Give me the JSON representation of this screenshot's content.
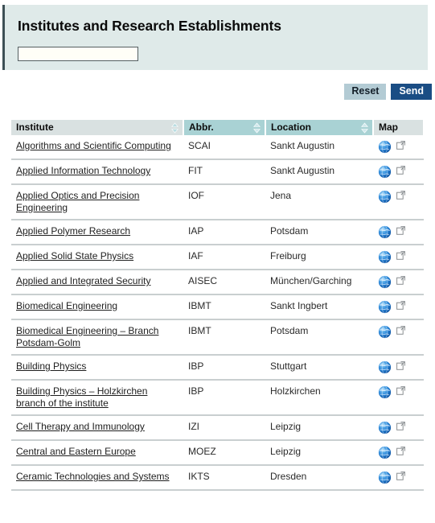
{
  "header": {
    "title": "Institutes and Research Establishments",
    "search": {
      "value": "",
      "placeholder": ""
    }
  },
  "actions": {
    "reset_label": "Reset",
    "send_label": "Send"
  },
  "colors": {
    "panel_bg": "#dfeae9",
    "header_plain": "#d9e1e1",
    "header_accent": "#a9d2d4",
    "send_bg": "#1a4d84",
    "reset_bg": "#b3cbd4",
    "globe_blue": "#1c6fc4",
    "row_divider": "#c9cfd0"
  },
  "table": {
    "columns": [
      {
        "key": "institute",
        "label": "Institute",
        "sortable": true,
        "icon": "sort-arrows-icon"
      },
      {
        "key": "abbr",
        "label": "Abbr.",
        "sortable": true,
        "icon": "sort-arrows-icon"
      },
      {
        "key": "location",
        "label": "Location",
        "sortable": true,
        "icon": "sort-arrows-icon"
      },
      {
        "key": "map",
        "label": "Map",
        "sortable": false,
        "icon": ""
      }
    ],
    "rows": [
      {
        "institute": "Algorithms and Scientific Computing",
        "abbr": "SCAI",
        "location": "Sankt Augustin",
        "map_icon": "globe-icon",
        "link_icon": "external-link-icon"
      },
      {
        "institute": "Applied Information Technology",
        "abbr": "FIT",
        "location": "Sankt Augustin",
        "map_icon": "globe-icon",
        "link_icon": "external-link-icon"
      },
      {
        "institute": "Applied Optics and Precision Engineering",
        "abbr": "IOF",
        "location": "Jena",
        "map_icon": "globe-icon",
        "link_icon": "external-link-icon"
      },
      {
        "institute": "Applied Polymer Research",
        "abbr": "IAP",
        "location": "Potsdam",
        "map_icon": "globe-icon",
        "link_icon": "external-link-icon"
      },
      {
        "institute": "Applied Solid State Physics",
        "abbr": "IAF",
        "location": "Freiburg",
        "map_icon": "globe-icon",
        "link_icon": "external-link-icon"
      },
      {
        "institute": "Applied and Integrated Security",
        "abbr": "AISEC",
        "location": "München/Garching",
        "map_icon": "globe-icon",
        "link_icon": "external-link-icon"
      },
      {
        "institute": "Biomedical Engineering",
        "abbr": "IBMT",
        "location": "Sankt Ingbert",
        "map_icon": "globe-icon",
        "link_icon": "external-link-icon"
      },
      {
        "institute": "Biomedical Engineering – Branch Potsdam-Golm",
        "abbr": "IBMT",
        "location": "Potsdam",
        "map_icon": "globe-icon",
        "link_icon": "external-link-icon"
      },
      {
        "institute": "Building Physics",
        "abbr": "IBP",
        "location": "Stuttgart",
        "map_icon": "globe-icon",
        "link_icon": "external-link-icon"
      },
      {
        "institute": "Building Physics – Holzkirchen branch of the institute",
        "abbr": "IBP",
        "location": "Holzkirchen",
        "map_icon": "globe-icon",
        "link_icon": "external-link-icon"
      },
      {
        "institute": "Cell Therapy and Immunology",
        "abbr": "IZI",
        "location": "Leipzig",
        "map_icon": "globe-icon",
        "link_icon": "external-link-icon"
      },
      {
        "institute": "Central and Eastern Europe",
        "abbr": "MOEZ",
        "location": "Leipzig",
        "map_icon": "globe-icon",
        "link_icon": "external-link-icon"
      },
      {
        "institute": "Ceramic Technologies and Systems",
        "abbr": "IKTS",
        "location": "Dresden",
        "map_icon": "globe-icon",
        "link_icon": "external-link-icon"
      }
    ]
  }
}
